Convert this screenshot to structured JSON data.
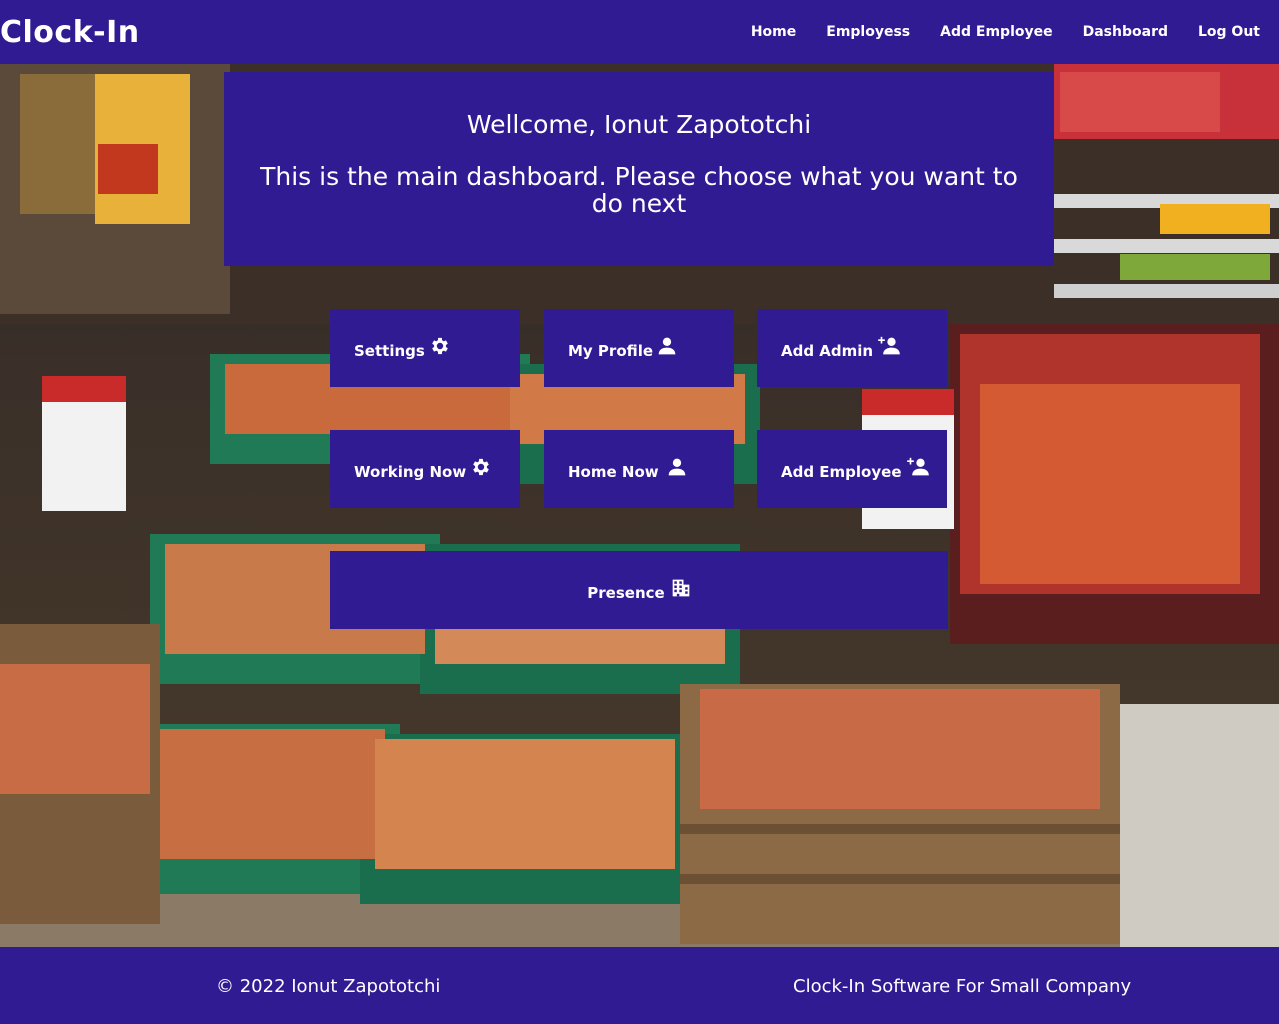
{
  "navbar": {
    "brand": "Clock-In",
    "links": [
      "Home",
      "Employess",
      "Add Employee",
      "Dashboard",
      "Log Out"
    ]
  },
  "welcome": {
    "title": "Wellcome, Ionut Zapototchi",
    "subtitle": "This is the main dashboard. Please choose what you want to do next"
  },
  "tiles": {
    "settings": {
      "label": "Settings",
      "icon": "gear-icon"
    },
    "my_profile": {
      "label": "My Profile",
      "icon": "user-icon"
    },
    "add_admin": {
      "label": "Add Admin",
      "icon": "user-plus-icon"
    },
    "working_now": {
      "label": "Working Now",
      "icon": "gear-icon"
    },
    "home_now": {
      "label": "Home Now",
      "icon": "user-icon"
    },
    "add_employee": {
      "label": "Add Employee",
      "icon": "user-plus-icon"
    },
    "presence": {
      "label": "Presence",
      "icon": "building-icon"
    }
  },
  "footer": {
    "copyright": "© 2022 Ionut Zapototchi",
    "tagline": "Clock-In Software For Small Company"
  },
  "colors": {
    "primary": "#311b92",
    "text": "#ffffff"
  }
}
